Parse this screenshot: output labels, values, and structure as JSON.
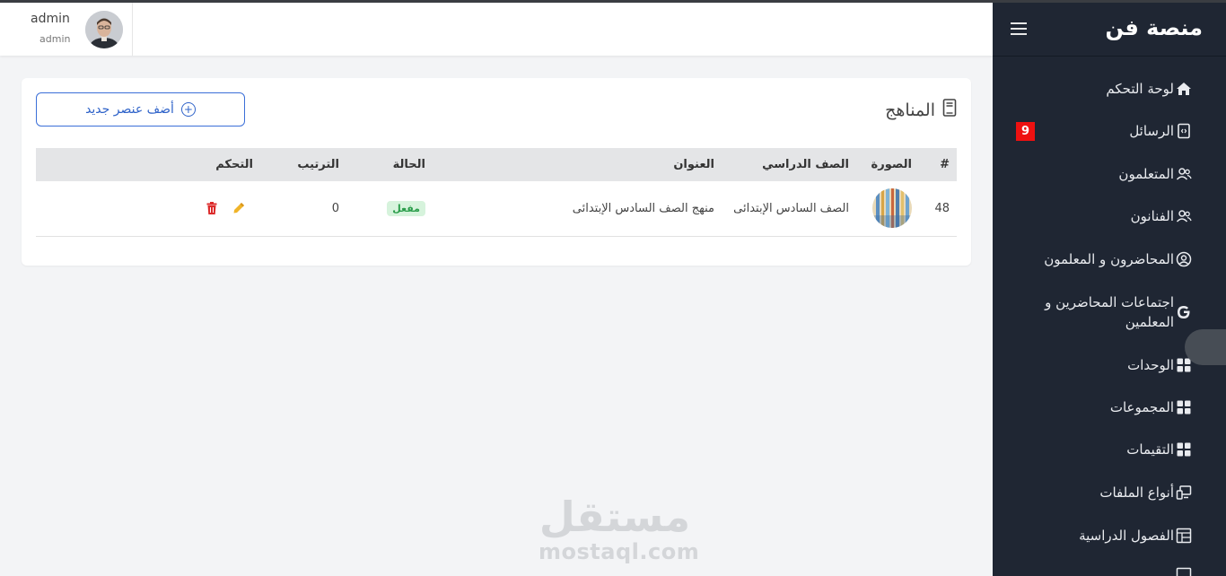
{
  "header": {
    "user_name": "admin",
    "user_role": "admin"
  },
  "sidebar": {
    "brand": "منصة فن",
    "items": [
      {
        "label": "لوحة التحكم",
        "icon": "home-icon"
      },
      {
        "label": "الرسائل",
        "icon": "message-code-icon",
        "badge": "9"
      },
      {
        "label": "المتعلمون",
        "icon": "users-icon"
      },
      {
        "label": "الفنانون",
        "icon": "users-icon"
      },
      {
        "label": "المحاضرون و المعلمون",
        "icon": "user-circle-icon"
      },
      {
        "label": "اجتماعات المحاضرين و المعلمين",
        "icon": "google-icon"
      },
      {
        "label": "الوحدات",
        "icon": "grid-icon"
      },
      {
        "label": "المجموعات",
        "icon": "grid-icon"
      },
      {
        "label": "التقيمات",
        "icon": "grid-icon"
      },
      {
        "label": "أنواع الملفات",
        "icon": "devices-icon"
      },
      {
        "label": "الفصول الدراسية",
        "icon": "layout-icon"
      }
    ]
  },
  "main": {
    "title": "المناهج",
    "add_button": "أضف عنصر جديد",
    "table": {
      "columns": [
        "#",
        "الصورة",
        "الصف الدراسي",
        "العنوان",
        "الحالة",
        "الترتيب",
        "التحكم"
      ],
      "rows": [
        {
          "id": "48",
          "grade": "الصف السادس الإبتدائى",
          "title": "منهج الصف السادس الإبتدائى",
          "status": "مفعل",
          "order": "0"
        }
      ]
    }
  },
  "watermark": {
    "arabic": "مستقل",
    "latin": "mostaql.com"
  },
  "colors": {
    "sidebar_bg": "#1f2633",
    "accent": "#2f63c9",
    "badge": "#ee1111",
    "status_bg": "#d6f3dc",
    "status_text": "#2a9d4a"
  }
}
